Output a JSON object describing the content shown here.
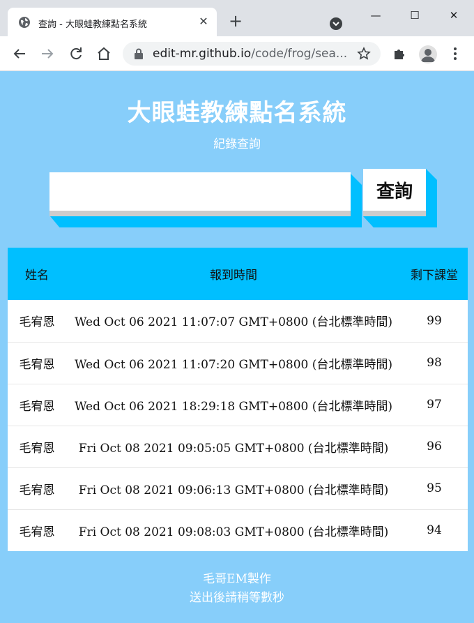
{
  "browser": {
    "tab_title": "查詢 - 大眼蛙教練點名系統",
    "url_host": "edit-mr.github.io",
    "url_path": "/code/frog/sea..."
  },
  "page": {
    "title": "大眼蛙教練點名系統",
    "subtitle": "紀錄查詢",
    "search_value": "",
    "query_button_label": "查詢"
  },
  "table": {
    "headers": [
      "姓名",
      "報到時間",
      "剩下課堂"
    ],
    "rows": [
      {
        "name": "毛宥恩",
        "time": "Wed Oct 06 2021 11:07:07 GMT+0800 (台北標準時間)",
        "remaining": "99"
      },
      {
        "name": "毛宥恩",
        "time": "Wed Oct 06 2021 11:07:20 GMT+0800 (台北標準時間)",
        "remaining": "98"
      },
      {
        "name": "毛宥恩",
        "time": "Wed Oct 06 2021 18:29:18 GMT+0800 (台北標準時間)",
        "remaining": "97"
      },
      {
        "name": "毛宥恩",
        "time": "Fri Oct 08 2021 09:05:05 GMT+0800 (台北標準時間)",
        "remaining": "96"
      },
      {
        "name": "毛宥恩",
        "time": "Fri Oct 08 2021 09:06:13 GMT+0800 (台北標準時間)",
        "remaining": "95"
      },
      {
        "name": "毛宥恩",
        "time": "Fri Oct 08 2021 09:08:03 GMT+0800 (台北標準時間)",
        "remaining": "94"
      }
    ]
  },
  "footer": {
    "credit": "毛哥EM製作",
    "note": "送出後請稍等數秒"
  },
  "colors": {
    "page_background": "#87cefa",
    "accent": "#00bfff"
  }
}
